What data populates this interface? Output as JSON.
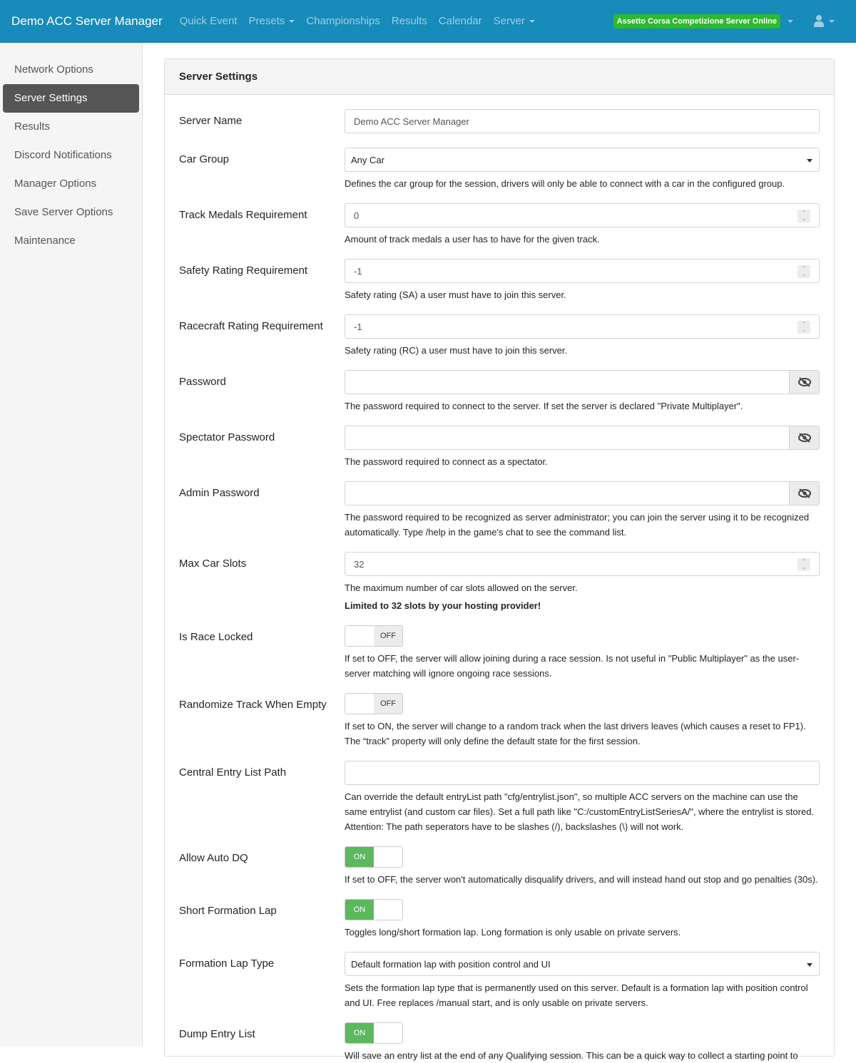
{
  "navbar": {
    "brand": "Demo ACC Server Manager",
    "links": [
      {
        "label": "Quick Event",
        "dropdown": false
      },
      {
        "label": "Presets",
        "dropdown": true
      },
      {
        "label": "Championships",
        "dropdown": false
      },
      {
        "label": "Results",
        "dropdown": false
      },
      {
        "label": "Calendar",
        "dropdown": false
      },
      {
        "label": "Server",
        "dropdown": true
      }
    ],
    "status_badge": "Assetto Corsa Competizione Server Online",
    "status_color": "#2eb82e",
    "user_icon": "user-icon"
  },
  "sidebar": {
    "items": [
      {
        "label": "Network Options",
        "active": false
      },
      {
        "label": "Server Settings",
        "active": true
      },
      {
        "label": "Results",
        "active": false
      },
      {
        "label": "Discord Notifications",
        "active": false
      },
      {
        "label": "Manager Options",
        "active": false
      },
      {
        "label": "Save Server Options",
        "active": false
      },
      {
        "label": "Maintenance",
        "active": false
      }
    ]
  },
  "card": {
    "title": "Server Settings",
    "fields": {
      "server_name": {
        "label": "Server Name",
        "value": "Demo ACC Server Manager"
      },
      "car_group": {
        "label": "Car Group",
        "value": "Any Car",
        "help": "Defines the car group for the session, drivers will only be able to connect with a car in the configured group."
      },
      "track_medals": {
        "label": "Track Medals Requirement",
        "value": "0",
        "help": "Amount of track medals a user has to have for the given track."
      },
      "safety_rating": {
        "label": "Safety Rating Requirement",
        "value": "-1",
        "help": "Safety rating (SA) a user must have to join this server."
      },
      "racecraft_rating": {
        "label": "Racecraft Rating Requirement",
        "value": "-1",
        "help": "Safety rating (RC) a user must have to join this server."
      },
      "password": {
        "label": "Password",
        "value": "",
        "help": "The password required to connect to the server. If set the server is declared \"Private Multiplayer\"."
      },
      "spectator_password": {
        "label": "Spectator Password",
        "value": "",
        "help": "The password required to connect as a spectator."
      },
      "admin_password": {
        "label": "Admin Password",
        "value": "",
        "help": "The password required to be recognized as server administrator; you can join the server using it to be recognized automatically. Type /help in the game's chat to see the command list."
      },
      "max_car_slots": {
        "label": "Max Car Slots",
        "value": "32",
        "help": "The maximum number of car slots allowed on the server.",
        "warning": "Limited to 32 slots by your hosting provider!"
      },
      "is_race_locked": {
        "label": "Is Race Locked",
        "state": "OFF",
        "help": "If set to OFF, the server will allow joining during a race session. Is not useful in \"Public Multiplayer\" as the user-server matching will ignore ongoing race sessions."
      },
      "randomize_track": {
        "label": "Randomize Track When Empty",
        "state": "OFF",
        "help": "If set to ON, the server will change to a random track when the last drivers leaves (which causes a reset to FP1). The “track” property will only define the default state for the first session."
      },
      "central_entry_list": {
        "label": "Central Entry List Path",
        "value": "",
        "help": "Can override the default entryList path \"cfg/entrylist.json\", so multiple ACC servers on the machine can use the same entrylist (and custom car files). Set a full path like \"C:/customEntryListSeriesA/\", where the entrylist is stored. Attention: The path seperators have to be slashes (/), backslashes (\\) will not work."
      },
      "allow_auto_dq": {
        "label": "Allow Auto DQ",
        "state": "ON",
        "help": "If set to OFF, the server won't automatically disqualify drivers, and will instead hand out stop and go penalties (30s)."
      },
      "short_formation_lap": {
        "label": "Short Formation Lap",
        "state": "ON",
        "help": "Toggles long/short formation lap. Long formation is only usable on private servers."
      },
      "formation_lap_type": {
        "label": "Formation Lap Type",
        "value": "Default formation lap with position control and UI",
        "help": "Sets the formation lap type that is permanently used on this server. Default is a formation lap with position control and UI. Free replaces /manual start, and is only usable on private servers."
      },
      "dump_entry_list": {
        "label": "Dump Entry List",
        "state": "ON",
        "help": "Will save an entry list at the end of any Qualifying session. This can be a quick way to collect a starting point to"
      }
    }
  },
  "colors": {
    "navbar": "#178bba",
    "toggle_on": "#5cb85c",
    "sidebar_active": "#555555"
  }
}
